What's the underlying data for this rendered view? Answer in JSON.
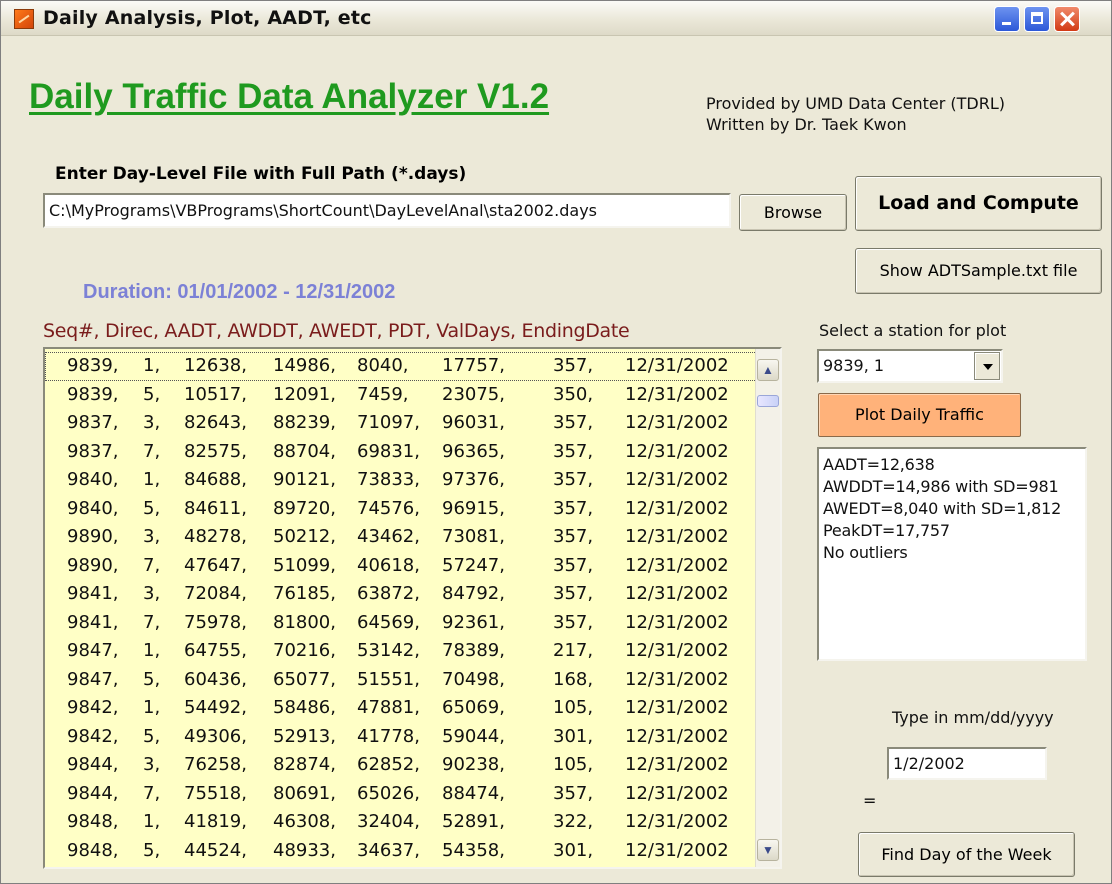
{
  "window": {
    "title": "Daily Analysis, Plot, AADT, etc"
  },
  "header": {
    "app_title": "Daily Traffic Data Analyzer V1.2",
    "credit_line1": "Provided by UMD Data Center (TDRL)",
    "credit_line2": "Written by Dr. Taek Kwon"
  },
  "file": {
    "label": "Enter Day-Level File with Full Path (*.days)",
    "path_value": "C:\\MyPrograms\\VBPrograms\\ShortCount\\DayLevelAnal\\sta2002.days",
    "browse_label": "Browse",
    "load_label": "Load and Compute",
    "show_label": "Show ADTSample.txt file"
  },
  "duration": "Duration: 01/01/2002 - 12/31/2002",
  "list": {
    "header": "Seq#, Direc, AADT, AWDDT, AWEDT, PDT, ValDays, EndingDate",
    "selected_index": 0,
    "scroll_position": 0.03,
    "rows": [
      [
        "9839,",
        "1,",
        "12638,",
        "14986,",
        "8040,",
        "17757,",
        "357,",
        "12/31/2002"
      ],
      [
        "9839,",
        "5,",
        "10517,",
        "12091,",
        "7459,",
        "23075,",
        "350,",
        "12/31/2002"
      ],
      [
        "9837,",
        "3,",
        "82643,",
        "88239,",
        "71097,",
        "96031,",
        "357,",
        "12/31/2002"
      ],
      [
        "9837,",
        "7,",
        "82575,",
        "88704,",
        "69831,",
        "96365,",
        "357,",
        "12/31/2002"
      ],
      [
        "9840,",
        "1,",
        "84688,",
        "90121,",
        "73833,",
        "97376,",
        "357,",
        "12/31/2002"
      ],
      [
        "9840,",
        "5,",
        "84611,",
        "89720,",
        "74576,",
        "96915,",
        "357,",
        "12/31/2002"
      ],
      [
        "9890,",
        "3,",
        "48278,",
        "50212,",
        "43462,",
        "73081,",
        "357,",
        "12/31/2002"
      ],
      [
        "9890,",
        "7,",
        "47647,",
        "51099,",
        "40618,",
        "57247,",
        "357,",
        "12/31/2002"
      ],
      [
        "9841,",
        "3,",
        "72084,",
        "76185,",
        "63872,",
        "84792,",
        "357,",
        "12/31/2002"
      ],
      [
        "9841,",
        "7,",
        "75978,",
        "81800,",
        "64569,",
        "92361,",
        "357,",
        "12/31/2002"
      ],
      [
        "9847,",
        "1,",
        "64755,",
        "70216,",
        "53142,",
        "78389,",
        "217,",
        "12/31/2002"
      ],
      [
        "9847,",
        "5,",
        "60436,",
        "65077,",
        "51551,",
        "70498,",
        "168,",
        "12/31/2002"
      ],
      [
        "9842,",
        "1,",
        "54492,",
        "58486,",
        "47881,",
        "65069,",
        "105,",
        "12/31/2002"
      ],
      [
        "9842,",
        "5,",
        "49306,",
        "52913,",
        "41778,",
        "59044,",
        "301,",
        "12/31/2002"
      ],
      [
        "9844,",
        "3,",
        "76258,",
        "82874,",
        "62852,",
        "90238,",
        "105,",
        "12/31/2002"
      ],
      [
        "9844,",
        "7,",
        "75518,",
        "80691,",
        "65026,",
        "88474,",
        "357,",
        "12/31/2002"
      ],
      [
        "9848,",
        "1,",
        "41819,",
        "46308,",
        "32404,",
        "52891,",
        "322,",
        "12/31/2002"
      ],
      [
        "9848,",
        "5,",
        "44524,",
        "48933,",
        "34637,",
        "54358,",
        "301,",
        "12/31/2002"
      ]
    ]
  },
  "plot": {
    "station_label": "Select a station for plot",
    "station_value": "9839, 1",
    "plot_button": "Plot Daily Traffic",
    "stats": [
      "AADT=12,638",
      "AWDDT=14,986 with SD=981",
      "AWEDT=8,040 with SD=1,812",
      "PeakDT=17,757",
      "No outliers"
    ]
  },
  "weekday": {
    "label": "Type in mm/dd/yyyy",
    "date_value": "1/2/2002",
    "result": "=",
    "find_button": "Find Day of the Week"
  },
  "icons": {
    "app": "app-icon",
    "minimize": "minimize-icon",
    "maximize": "maximize-icon",
    "close": "close-icon",
    "dropdown": "chevron-down-icon",
    "scroll_up": "scroll-up-icon",
    "scroll_down": "scroll-down-icon"
  }
}
